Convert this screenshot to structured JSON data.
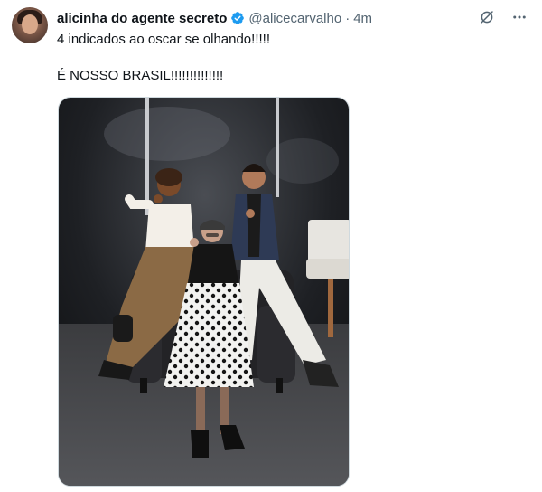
{
  "tweet": {
    "display_name": "alicinha do agente secreto",
    "handle": "@alicecarvalho",
    "separator": "·",
    "time": "4m",
    "text_line1": "4 indicados ao oscar se olhando!!!!!",
    "text_line2": "É NOSSO BRASIL!!!!!!!!!!!!!!"
  },
  "colors": {
    "verified_badge": "#1d9bf0",
    "secondary_text": "#536471"
  },
  "icons": [
    "avatar",
    "verified-icon",
    "grok-icon",
    "more-icon"
  ]
}
